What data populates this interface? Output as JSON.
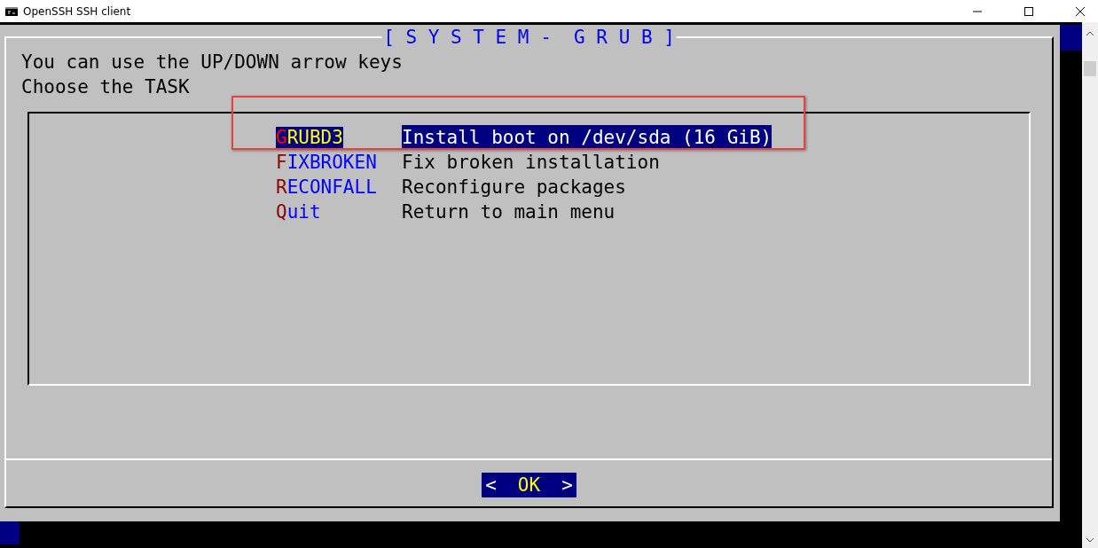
{
  "window": {
    "title": "OpenSSH SSH client"
  },
  "dialog": {
    "title": "[ S Y S T E M -  G R U B ]",
    "lines": [
      "You can use the UP/DOWN arrow keys",
      "Choose the TASK"
    ],
    "items": [
      {
        "tag": "GRUBD3",
        "description": "Install boot on /dev/sda (16 GiB)",
        "selected": true
      },
      {
        "tag": "FIXBROKEN",
        "description": "Fix broken installation",
        "selected": false
      },
      {
        "tag": "RECONFALL",
        "description": "Reconfigure packages",
        "selected": false
      },
      {
        "tag": "Quit",
        "description": "Return to main menu",
        "selected": false
      }
    ],
    "button": {
      "left": "<",
      "label": "OK",
      "right": ">"
    }
  }
}
